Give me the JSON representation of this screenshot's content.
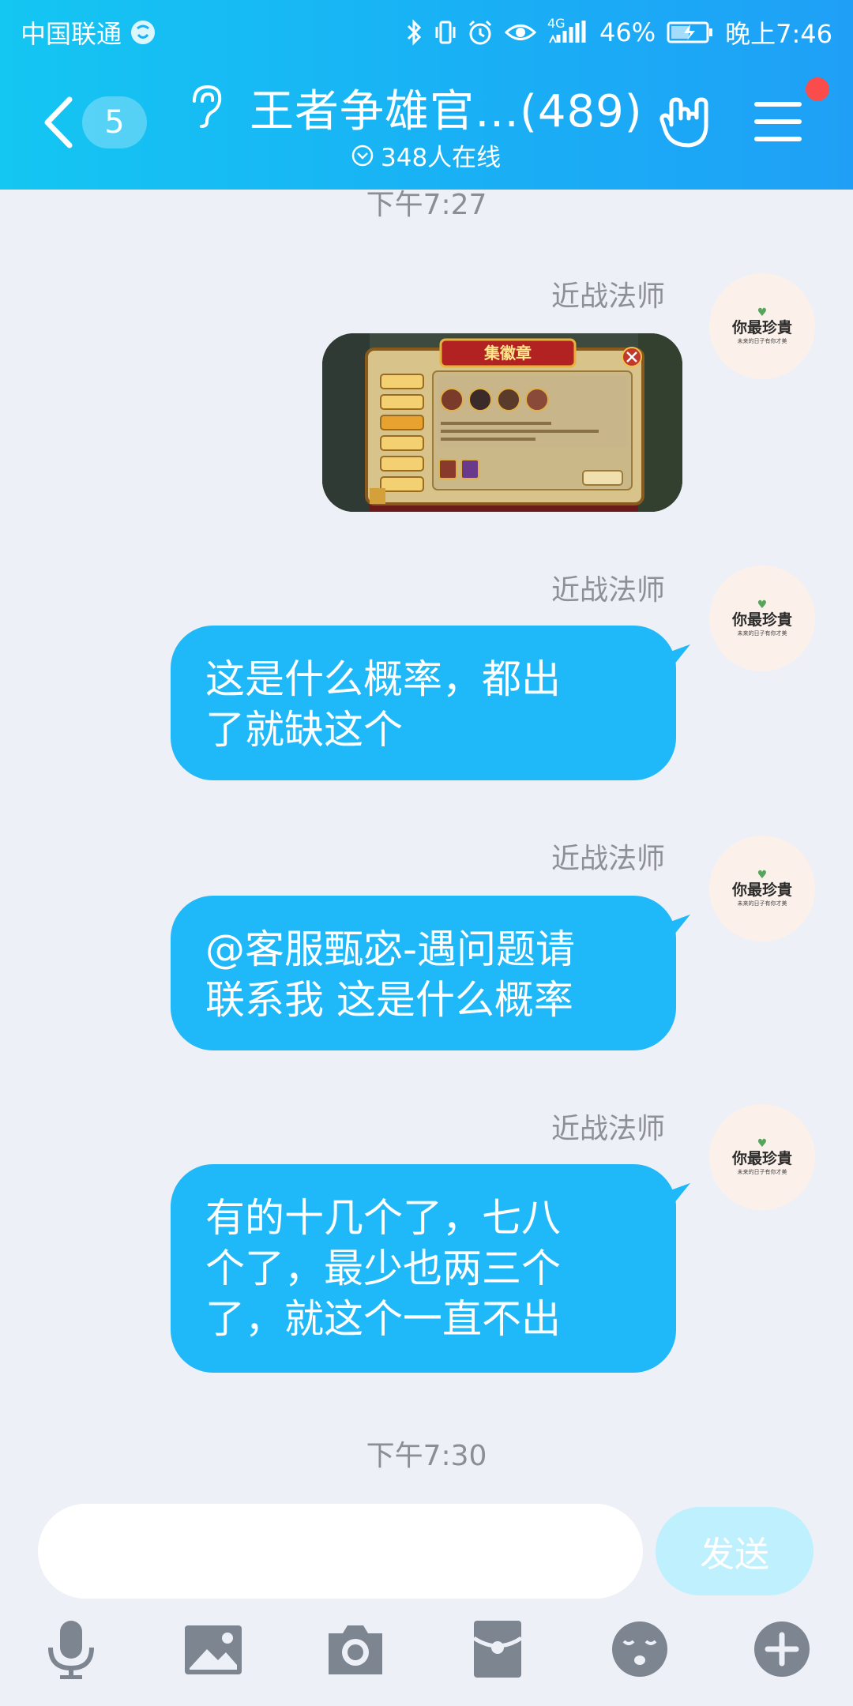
{
  "status_bar": {
    "carrier": "中国联通",
    "network": "4G",
    "battery": "46%",
    "time": "晚上7:46"
  },
  "header": {
    "unread_count": "5",
    "group_title": "王者争雄官…(489)",
    "online_text": "348人在线"
  },
  "messages": [
    {
      "type": "timestamp",
      "text": "下午7:27"
    },
    {
      "type": "image",
      "sender": "近战法师",
      "image_title": "集徽章"
    },
    {
      "type": "text",
      "sender": "近战法师",
      "lines": [
        "这是什么概率，都出",
        "了就缺这个"
      ]
    },
    {
      "type": "text",
      "sender": "近战法师",
      "lines": [
        "@客服甄宓-遇问题请",
        "联系我 这是什么概率"
      ]
    },
    {
      "type": "text",
      "sender": "近战法师",
      "lines": [
        "有的十几个了，七八",
        "个了，最少也两三个",
        "了，就这个一直不出"
      ]
    },
    {
      "type": "timestamp",
      "text": "下午7:30"
    }
  ],
  "avatar": {
    "main": "你最珍貴",
    "sub": "未来的日子有你才美"
  },
  "input": {
    "value": "",
    "send_label": "发送"
  },
  "toolbar": [
    "microphone-icon",
    "picture-icon",
    "camera-icon",
    "red-packet-icon",
    "emoji-icon",
    "plus-icon"
  ],
  "colors": {
    "header_gradient_start": "#14c6f2",
    "header_gradient_end": "#1fa0f6",
    "bubble": "#1fb8f8",
    "background": "#edf0f6",
    "send_button": "#bff0fd",
    "notification_dot": "#fb4c4c"
  }
}
